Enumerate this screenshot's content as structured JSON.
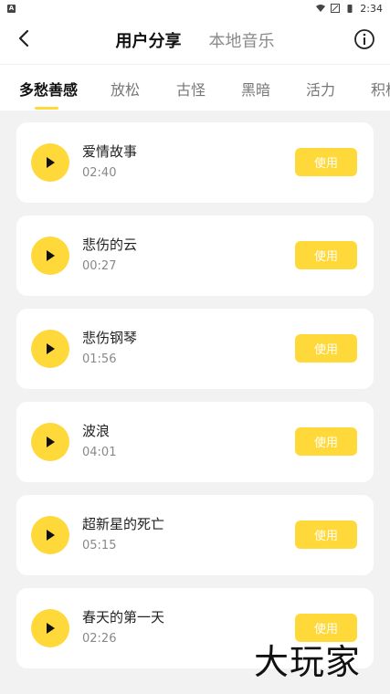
{
  "status_bar": {
    "left_icon": "A",
    "time": "2:34",
    "icons": [
      "wifi-icon",
      "signal-icon",
      "battery-icon"
    ]
  },
  "header": {
    "tabs": [
      {
        "label": "用户分享",
        "active": true
      },
      {
        "label": "本地音乐",
        "active": false
      }
    ],
    "back_icon": "back-arrow-icon",
    "info_icon": "info-icon"
  },
  "categories": [
    {
      "label": "多愁善感",
      "active": true
    },
    {
      "label": "放松",
      "active": false
    },
    {
      "label": "古怪",
      "active": false
    },
    {
      "label": "黑暗",
      "active": false
    },
    {
      "label": "活力",
      "active": false
    },
    {
      "label": "积极",
      "active": false
    }
  ],
  "tracks": [
    {
      "title": "爱情故事",
      "duration": "02:40",
      "button": "使用"
    },
    {
      "title": "悲伤的云",
      "duration": "00:27",
      "button": "使用"
    },
    {
      "title": "悲伤钢琴",
      "duration": "01:56",
      "button": "使用"
    },
    {
      "title": "波浪",
      "duration": "04:01",
      "button": "使用"
    },
    {
      "title": "超新星的死亡",
      "duration": "05:15",
      "button": "使用"
    },
    {
      "title": "春天的第一天",
      "duration": "02:26",
      "button": "使用"
    }
  ],
  "watermark": "大玩家",
  "colors": {
    "accent": "#ffd83a",
    "background": "#f2f2f2"
  }
}
